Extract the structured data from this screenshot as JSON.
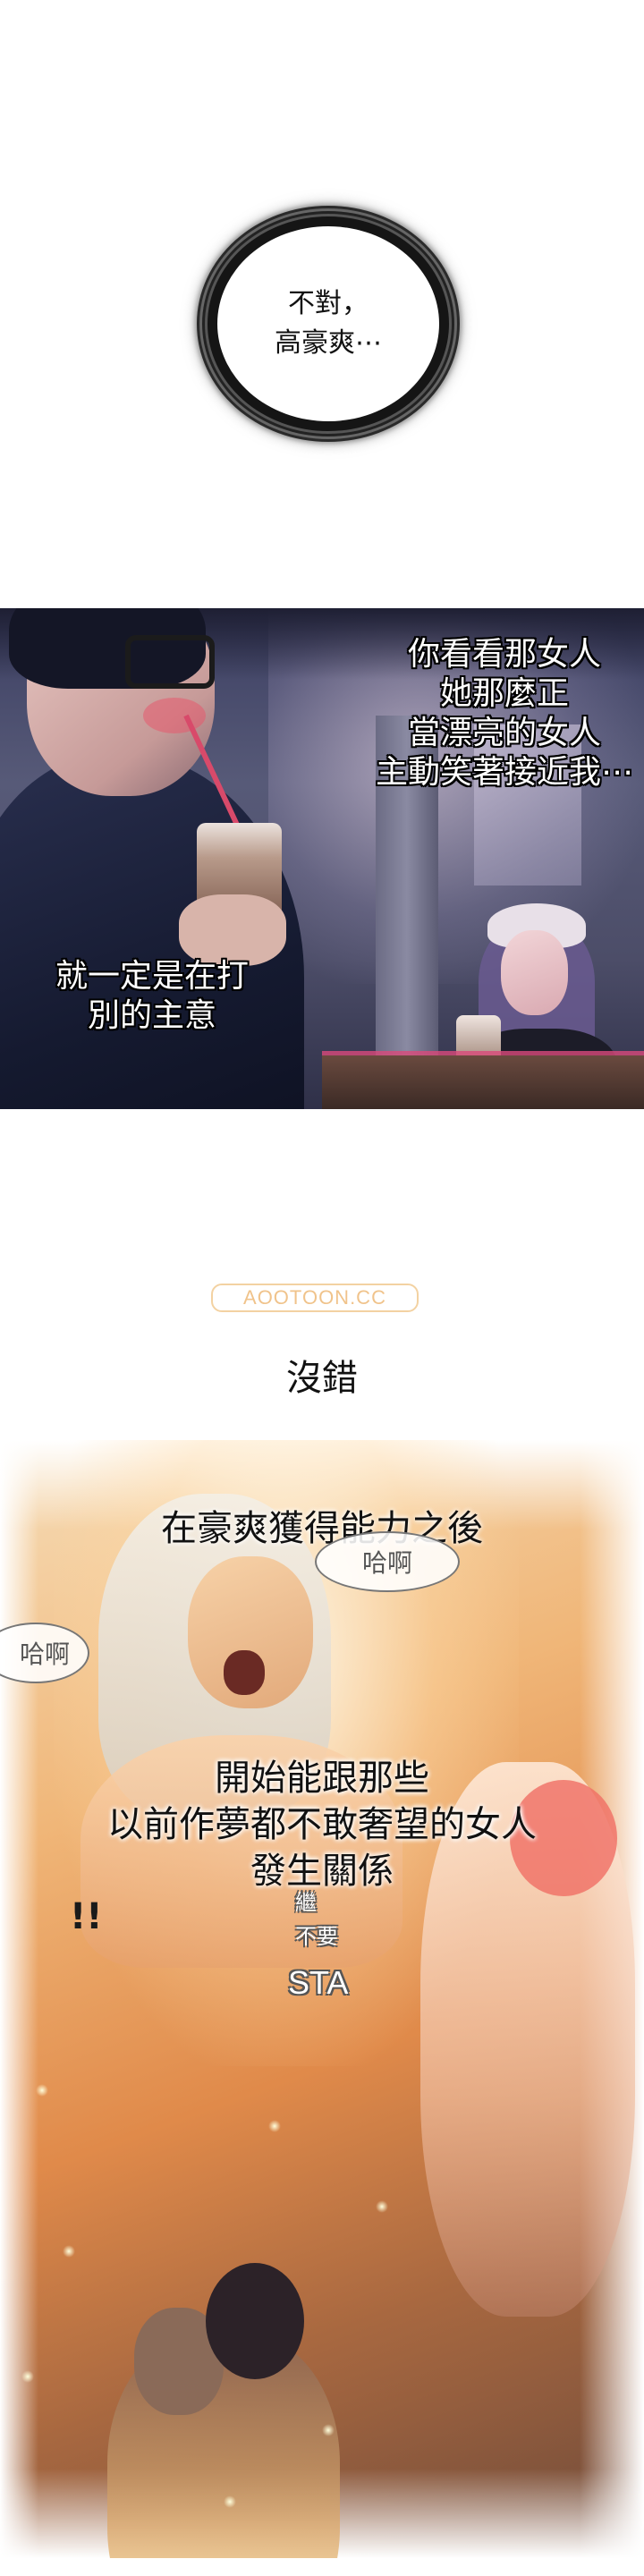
{
  "panel1": {
    "thought_lines": [
      "不對，",
      "高豪爽⋯"
    ]
  },
  "panel2": {
    "caption_right_lines": [
      "你看看那女人",
      "她那麼正",
      "當漂亮的女人",
      "主動笑著接近我⋯"
    ],
    "caption_left_lines": [
      "就一定是在打",
      "別的主意"
    ]
  },
  "watermark": {
    "text": "AOOTOON.CC"
  },
  "caption_correct": "沒錯",
  "panel3": {
    "caption_top": "在豪爽獲得能力之後",
    "sfx_right": "哈啊",
    "sfx_left": "哈啊",
    "caption_lines": [
      "開始能跟那些",
      "以前作夢都不敢奢望的女人",
      "發生關係"
    ],
    "sfx_marks": "!!",
    "sfx_continue_lines": [
      "繼",
      "不要"
    ],
    "sfx_sta": "STA"
  }
}
